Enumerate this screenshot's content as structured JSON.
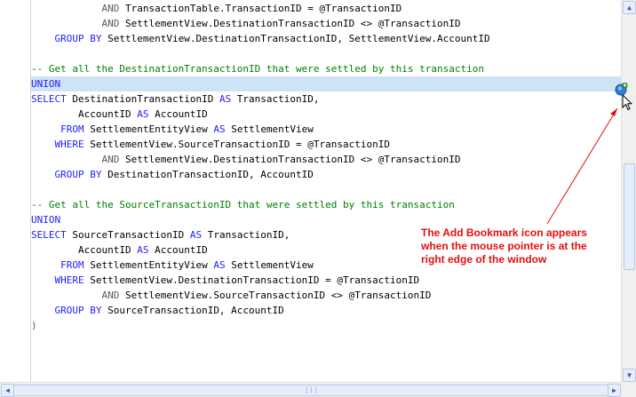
{
  "editor": {
    "lines": [
      {
        "indent": "            ",
        "tokens": [
          {
            "t": "AND",
            "c": "op"
          },
          {
            "t": " TransactionTable.TransactionID = @TransactionID",
            "c": "pl"
          }
        ]
      },
      {
        "indent": "            ",
        "tokens": [
          {
            "t": "AND",
            "c": "op"
          },
          {
            "t": " SettlementView.DestinationTransactionID <> @TransactionID",
            "c": "pl"
          }
        ]
      },
      {
        "indent": "    ",
        "tokens": [
          {
            "t": "GROUP BY",
            "c": "kw"
          },
          {
            "t": " SettlementView.DestinationTransactionID, SettlementView.AccountID",
            "c": "pl"
          }
        ]
      },
      {
        "indent": "",
        "tokens": []
      },
      {
        "indent": "",
        "tokens": [
          {
            "t": "-- Get all the DestinationTransactionID that were settled by this transaction",
            "c": "cm"
          }
        ]
      },
      {
        "indent": "",
        "tokens": [
          {
            "t": "UNION",
            "c": "kw"
          }
        ],
        "highlight": true
      },
      {
        "indent": "",
        "tokens": [
          {
            "t": "SELECT",
            "c": "kw"
          },
          {
            "t": " DestinationTransactionID ",
            "c": "pl"
          },
          {
            "t": "AS",
            "c": "kw"
          },
          {
            "t": " TransactionID,",
            "c": "pl"
          }
        ]
      },
      {
        "indent": "        ",
        "tokens": [
          {
            "t": "AccountID ",
            "c": "pl"
          },
          {
            "t": "AS",
            "c": "kw"
          },
          {
            "t": " AccountID",
            "c": "pl"
          }
        ]
      },
      {
        "indent": "     ",
        "tokens": [
          {
            "t": "FROM",
            "c": "kw"
          },
          {
            "t": " SettlementEntityView ",
            "c": "pl"
          },
          {
            "t": "AS",
            "c": "kw"
          },
          {
            "t": " SettlementView",
            "c": "pl"
          }
        ]
      },
      {
        "indent": "    ",
        "tokens": [
          {
            "t": "WHERE",
            "c": "kw"
          },
          {
            "t": " SettlementView.SourceTransactionID = @TransactionID",
            "c": "pl"
          }
        ]
      },
      {
        "indent": "            ",
        "tokens": [
          {
            "t": "AND",
            "c": "op"
          },
          {
            "t": " SettlementView.DestinationTransactionID <> @TransactionID",
            "c": "pl"
          }
        ]
      },
      {
        "indent": "    ",
        "tokens": [
          {
            "t": "GROUP BY",
            "c": "kw"
          },
          {
            "t": " DestinationTransactionID, AccountID",
            "c": "pl"
          }
        ]
      },
      {
        "indent": "",
        "tokens": []
      },
      {
        "indent": "",
        "tokens": [
          {
            "t": "-- Get all the SourceTransactionID that were settled by this transaction",
            "c": "cm"
          }
        ]
      },
      {
        "indent": "",
        "tokens": [
          {
            "t": "UNION",
            "c": "kw"
          }
        ]
      },
      {
        "indent": "",
        "tokens": [
          {
            "t": "SELECT",
            "c": "kw"
          },
          {
            "t": " SourceTransactionID ",
            "c": "pl"
          },
          {
            "t": "AS",
            "c": "kw"
          },
          {
            "t": " TransactionID,",
            "c": "pl"
          }
        ]
      },
      {
        "indent": "        ",
        "tokens": [
          {
            "t": "AccountID ",
            "c": "pl"
          },
          {
            "t": "AS",
            "c": "kw"
          },
          {
            "t": " AccountID",
            "c": "pl"
          }
        ]
      },
      {
        "indent": "     ",
        "tokens": [
          {
            "t": "FROM",
            "c": "kw"
          },
          {
            "t": " SettlementEntityView ",
            "c": "pl"
          },
          {
            "t": "AS",
            "c": "kw"
          },
          {
            "t": " SettlementView",
            "c": "pl"
          }
        ]
      },
      {
        "indent": "    ",
        "tokens": [
          {
            "t": "WHERE",
            "c": "kw"
          },
          {
            "t": " SettlementView.DestinationTransactionID = @TransactionID",
            "c": "pl"
          }
        ]
      },
      {
        "indent": "            ",
        "tokens": [
          {
            "t": "AND",
            "c": "op"
          },
          {
            "t": " SettlementView.SourceTransactionID <> @TransactionID",
            "c": "pl"
          }
        ]
      },
      {
        "indent": "    ",
        "tokens": [
          {
            "t": "GROUP BY",
            "c": "kw"
          },
          {
            "t": " SourceTransactionID, AccountID",
            "c": "pl"
          }
        ]
      },
      {
        "indent": "",
        "tokens": [
          {
            "t": ")",
            "c": "op"
          }
        ]
      }
    ]
  },
  "callout": {
    "line1": "The Add Bookmark icon appears",
    "line2": "when the mouse pointer is at the",
    "line3": "right edge of the window"
  },
  "icons": {
    "bookmark": "add-bookmark-icon",
    "cursor": "mouse-pointer-icon"
  },
  "colors": {
    "keyword": "#1e1eff",
    "comment": "#008000",
    "highlight": "#cfe3f7",
    "annotation": "#e01010"
  }
}
